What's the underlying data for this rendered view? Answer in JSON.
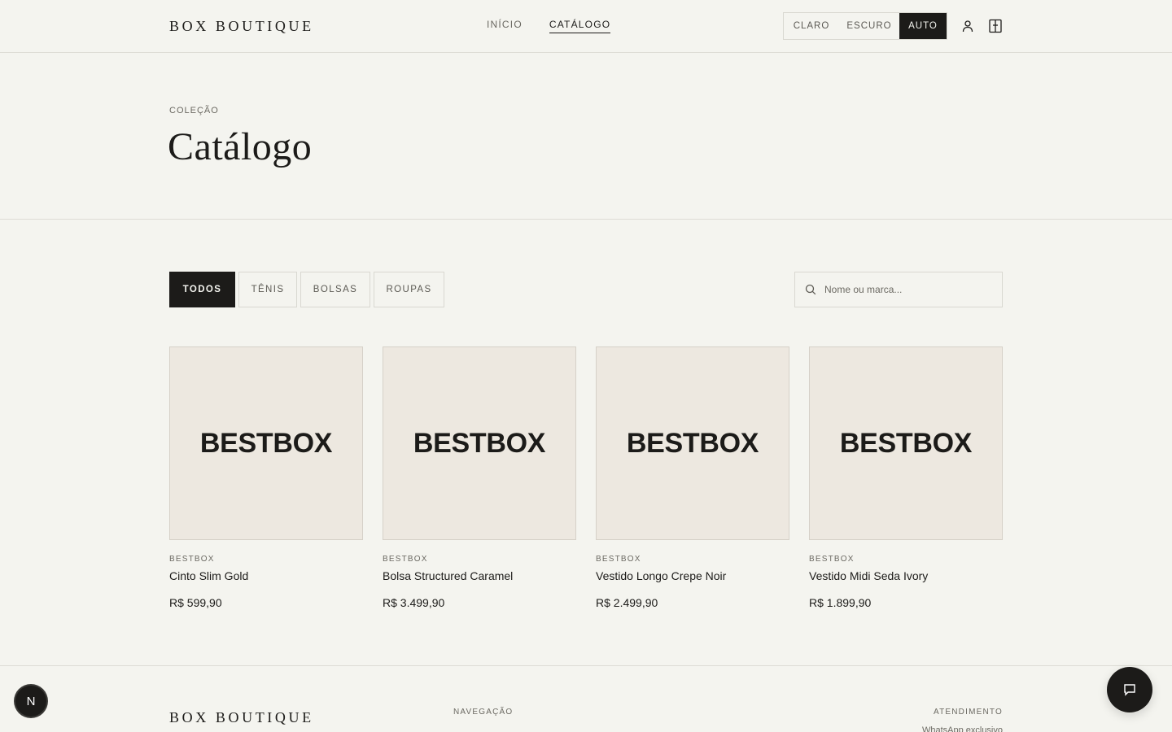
{
  "header": {
    "logo": "BOX BOUTIQUE",
    "nav": [
      {
        "label": "INÍCIO",
        "active": false
      },
      {
        "label": "CATÁLOGO",
        "active": true
      }
    ],
    "theme": {
      "options": [
        "CLARO",
        "ESCURO",
        "AUTO"
      ],
      "selected": "AUTO"
    },
    "icons": [
      "user-icon",
      "bag-icon"
    ]
  },
  "hero": {
    "eyebrow": "COLEÇÃO",
    "title": "Catálogo"
  },
  "filters": {
    "options": [
      "TODOS",
      "TÊNIS",
      "BOLSAS",
      "ROUPAS"
    ],
    "selected": "TODOS"
  },
  "search": {
    "placeholder": "Nome ou marca..."
  },
  "products": [
    {
      "image_text": "BESTBOX",
      "brand": "BESTBOX",
      "name": "Cinto Slim Gold",
      "price": "R$ 599,90"
    },
    {
      "image_text": "BESTBOX",
      "brand": "BESTBOX",
      "name": "Bolsa Structured Caramel",
      "price": "R$ 3.499,90"
    },
    {
      "image_text": "BESTBOX",
      "brand": "BESTBOX",
      "name": "Vestido Longo Crepe Noir",
      "price": "R$ 2.499,90"
    },
    {
      "image_text": "BESTBOX",
      "brand": "BESTBOX",
      "name": "Vestido Midi Seda Ivory",
      "price": "R$ 1.899,90"
    }
  ],
  "footer": {
    "logo": "BOX BOUTIQUE",
    "nav_heading": "NAVEGAÇÃO",
    "support_heading": "ATENDIMENTO",
    "support_value": "WhatsApp exclusivo"
  },
  "badge": {
    "label": "N"
  },
  "colors": {
    "background": "#f4f4ef",
    "ink": "#1c1b19",
    "muted": "#6b6962",
    "card": "#ede8e0"
  }
}
